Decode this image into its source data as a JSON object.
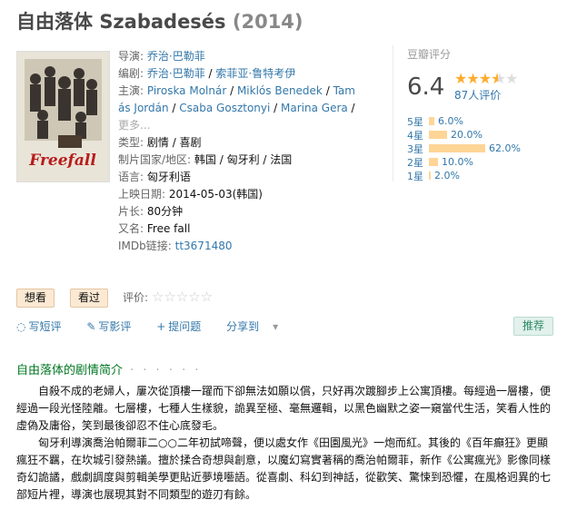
{
  "title": {
    "cn": "自由落体",
    "orig": "Szabadesés",
    "year": "(2014)"
  },
  "poster": {
    "text": "Freefall"
  },
  "info": {
    "director_label": "导演:",
    "director": "乔治·巴勒菲",
    "writers_label": "编剧:",
    "writer1": "乔治·巴勒菲",
    "writer2": "索菲亚·鲁特考伊",
    "cast_label": "主演:",
    "cast_line1": [
      "Piroska Molnár",
      "Miklós Benedek",
      "Tam"
    ],
    "cast_line2": [
      "ás Jordán",
      "Csaba Gosztonyi",
      "Marina Gera"
    ],
    "more": "更多...",
    "genre_label": "类型:",
    "genre": "剧情 / 喜剧",
    "country_label": "制片国家/地区:",
    "country": "韩国 / 匈牙利 / 法国",
    "language_label": "语言:",
    "language": "匈牙利语",
    "release_label": "上映日期:",
    "release": "2014-05-03(韩国)",
    "runtime_label": "片长:",
    "runtime": "80分钟",
    "aka_label": "又名:",
    "aka": "Free fall",
    "imdb_label": "IMDb链接:",
    "imdb": "tt3671480"
  },
  "rating": {
    "label": "豆瓣评分",
    "score": "6.4",
    "votes": "87人评价",
    "stars_filled": 3.5,
    "dist": [
      {
        "label": "5星",
        "pct": "6.0%",
        "value": 6.0
      },
      {
        "label": "4星",
        "pct": "20.0%",
        "value": 20.0
      },
      {
        "label": "3星",
        "pct": "62.0%",
        "value": 62.0
      },
      {
        "label": "2星",
        "pct": "10.0%",
        "value": 10.0
      },
      {
        "label": "1星",
        "pct": "2.0%",
        "value": 2.0
      }
    ]
  },
  "buttons": {
    "want": "想看",
    "seen": "看过",
    "rate_label": "评价:"
  },
  "actions": {
    "short_review": "写短评",
    "review": "写影评",
    "question": "提问题",
    "share": "分享到",
    "recommend": "推荐"
  },
  "summary": {
    "title": "自由落体的剧情简介",
    "dots": "· · · · · ·",
    "p1": "自殺不成的老婦人，屢次從頂樓一躍而下卻無法如願以償，只好再次踱腳步上公寓頂樓。每經過一層樓，便經過一段光怪陸離。七層樓，七種人生樣貌，詭異至極、毫無邏輯，以黑色幽默之姿一窺當代生活，笑看人性的虛偽及庸俗，笑到最後卻忍不住心底發毛。",
    "p2": "匈牙利導演喬治帕爾菲二○○二年初試啼聲，便以處女作《田園風光》一炮而紅。其後的《百年癲狂》更顯瘋狂不羈，在坎城引發熱議。擅於揉合奇想與創意，以魔幻寫實著稱的喬治帕爾菲，新作《公寓瘋光》影像同樣奇幻詭譎，戲劇調度與剪輯美學更貼近夢境囈語。從喜劇、科幻到神話，從歡笑、驚悚到恐懼，在風格迥異的七部短片裡，導演也展現其對不同類型的遊刃有餘。"
  }
}
